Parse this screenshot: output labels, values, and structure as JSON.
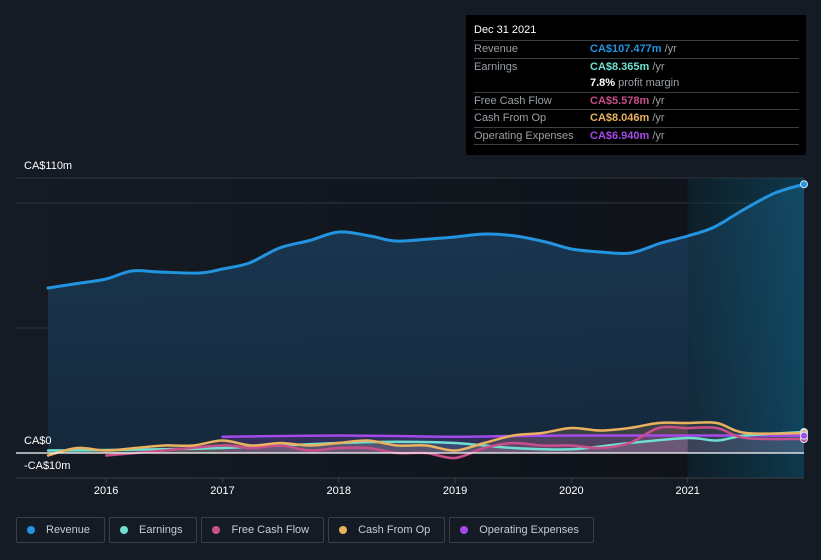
{
  "tooltip": {
    "date": "Dec 31 2021",
    "rows": [
      {
        "label": "Revenue",
        "value": "CA$107.477m",
        "unit": "/yr",
        "color": "#2394df"
      },
      {
        "label": "Earnings",
        "value": "CA$8.365m",
        "unit": "/yr",
        "color": "#6ee0d0"
      },
      {
        "label": "",
        "value": "7.8%",
        "unit": "profit margin",
        "color": "#ffffff"
      },
      {
        "label": "Free Cash Flow",
        "value": "CA$5.578m",
        "unit": "/yr",
        "color": "#c94f8a"
      },
      {
        "label": "Cash From Op",
        "value": "CA$8.046m",
        "unit": "/yr",
        "color": "#e9b25e"
      },
      {
        "label": "Operating Expenses",
        "value": "CA$6.940m",
        "unit": "/yr",
        "color": "#a34ae8"
      }
    ]
  },
  "legend": [
    {
      "label": "Revenue",
      "color": "#2394df"
    },
    {
      "label": "Earnings",
      "color": "#6ee0d0"
    },
    {
      "label": "Free Cash Flow",
      "color": "#c94f8a"
    },
    {
      "label": "Cash From Op",
      "color": "#e9b25e"
    },
    {
      "label": "Operating Expenses",
      "color": "#a34ae8"
    }
  ],
  "chart_data": {
    "type": "area",
    "title": "",
    "xlabel": "",
    "ylabel": "",
    "y_tick_labels": [
      "CA$110m",
      "CA$0",
      "-CA$10m"
    ],
    "x_tick_labels": [
      "2016",
      "2017",
      "2018",
      "2019",
      "2020",
      "2021"
    ],
    "ylim": [
      -10,
      110
    ],
    "xlim": [
      2015.5,
      2022.0
    ],
    "grid": true,
    "highlight_start": 2021.0,
    "series": [
      {
        "name": "Revenue",
        "color": "#2394df",
        "x": [
          2015.5,
          2015.78,
          2016.0,
          2016.22,
          2016.46,
          2016.8,
          2017.0,
          2017.23,
          2017.49,
          2017.75,
          2018.0,
          2018.27,
          2018.49,
          2018.78,
          2019.0,
          2019.26,
          2019.52,
          2019.78,
          2020.0,
          2020.25,
          2020.51,
          2020.77,
          2021.0,
          2021.23,
          2021.49,
          2021.75,
          2022.0
        ],
        "values": [
          66,
          68,
          69.6,
          72.8,
          72.4,
          72,
          73.6,
          76,
          82,
          85,
          88.4,
          86.8,
          84.8,
          85.6,
          86.4,
          87.6,
          86.8,
          84.4,
          81.6,
          80.4,
          80,
          84,
          86.8,
          90.4,
          97.6,
          104,
          107.5
        ]
      },
      {
        "name": "Earnings",
        "color": "#6ee0d0",
        "x": [
          2015.5,
          2016.0,
          2016.5,
          2017.0,
          2017.5,
          2018.0,
          2018.5,
          2019.0,
          2019.5,
          2020.0,
          2020.5,
          2021.0,
          2021.25,
          2021.5,
          2022.0
        ],
        "values": [
          1,
          1.2,
          1.5,
          2,
          3,
          4,
          4.5,
          4,
          2,
          1.5,
          4,
          6,
          5,
          7,
          8.4
        ]
      },
      {
        "name": "Free Cash Flow",
        "color": "#c94f8a",
        "x": [
          2016.0,
          2016.5,
          2017.0,
          2017.25,
          2017.5,
          2017.75,
          2018.0,
          2018.25,
          2018.5,
          2018.75,
          2019.0,
          2019.25,
          2019.5,
          2019.75,
          2020.0,
          2020.25,
          2020.5,
          2020.75,
          2021.0,
          2021.25,
          2021.5,
          2022.0
        ],
        "values": [
          -1,
          1,
          3,
          2,
          3,
          1,
          2,
          2,
          0,
          0,
          -2,
          2,
          4,
          3,
          3,
          2,
          4,
          10,
          10,
          10,
          6,
          5.6
        ]
      },
      {
        "name": "Cash From Op",
        "color": "#e9b25e",
        "x": [
          2015.5,
          2015.75,
          2016.0,
          2016.25,
          2016.5,
          2016.75,
          2017.0,
          2017.25,
          2017.5,
          2017.75,
          2018.0,
          2018.25,
          2018.5,
          2018.75,
          2019.0,
          2019.25,
          2019.5,
          2019.75,
          2020.0,
          2020.25,
          2020.5,
          2020.75,
          2021.0,
          2021.25,
          2021.5,
          2022.0
        ],
        "values": [
          -1,
          2,
          1,
          2,
          3,
          3,
          5,
          3,
          4,
          3,
          4,
          5,
          3,
          3,
          1,
          4,
          7,
          8,
          10,
          9,
          10,
          12,
          12,
          12,
          8,
          8
        ]
      },
      {
        "name": "Operating Expenses",
        "color": "#a34ae8",
        "x": [
          2017.0,
          2017.5,
          2018.0,
          2018.5,
          2019.0,
          2019.5,
          2020.0,
          2020.5,
          2021.0,
          2021.5,
          2022.0
        ],
        "values": [
          6.5,
          6.8,
          7,
          6.8,
          6.5,
          6.8,
          7,
          7,
          7,
          7,
          6.9
        ]
      }
    ]
  }
}
